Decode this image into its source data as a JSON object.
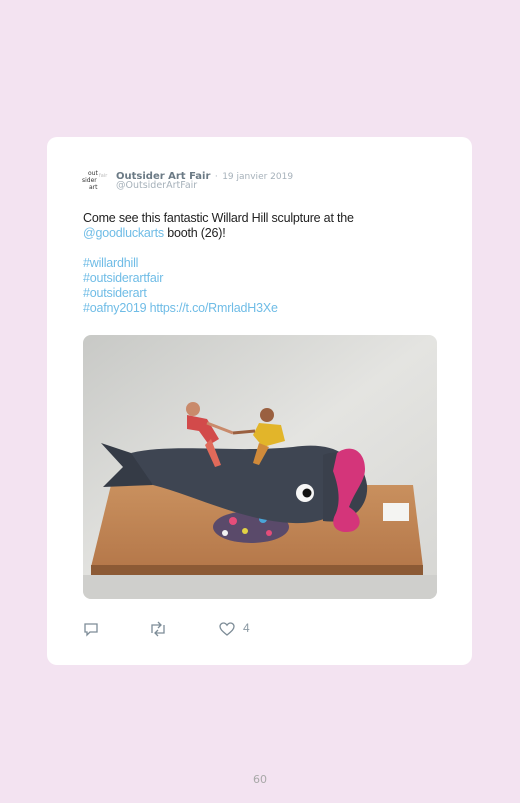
{
  "tweet": {
    "author_name": "Outsider Art Fair",
    "separator": "·",
    "date": "19 janvier 2019",
    "handle": "@OutsiderArtFair",
    "avatar": {
      "line1": "out",
      "line2": "sider",
      "line3": "art",
      "line4": "fair"
    },
    "text_before_mention": "Come see this fantastic Willard Hill sculpture at the ",
    "mention": "@goodluckarts",
    "text_after_mention": " booth (26)!",
    "hashtags": [
      "#willardhill",
      "#outsiderartfair",
      "#outsiderart",
      "#oafny2019"
    ],
    "short_link": "https://t.co/RmrladH3Xe",
    "actions": {
      "reply_icon": "reply-icon",
      "retweet_icon": "retweet-icon",
      "like_icon": "heart-icon",
      "like_count": "4"
    }
  },
  "page": {
    "number": "60"
  },
  "colors": {
    "background": "#f3e3f1",
    "card": "#ffffff",
    "link": "#6fbce6",
    "name": "#6b7a85",
    "muted": "#a6b1ba"
  }
}
